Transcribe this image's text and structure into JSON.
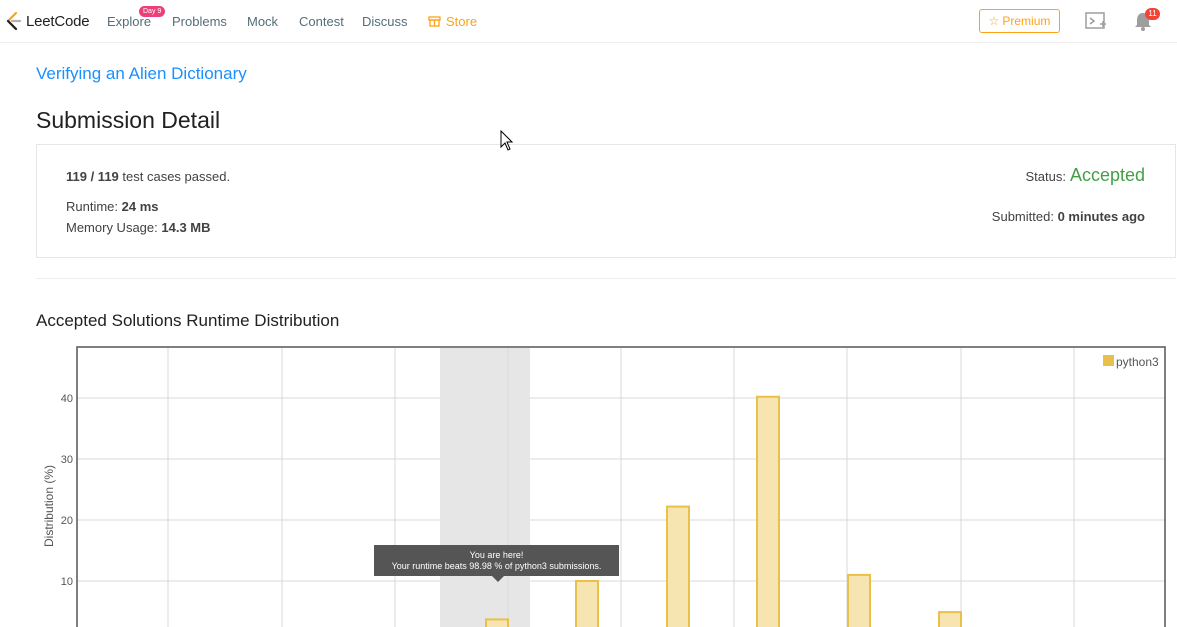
{
  "nav": {
    "logo_text": "LeetCode",
    "explore": "Explore",
    "explore_badge": "Day 9",
    "problems": "Problems",
    "mock": "Mock",
    "contest": "Contest",
    "discuss": "Discuss",
    "store": "Store",
    "premium": "Premium",
    "notification_count": "11"
  },
  "problem": {
    "title": "Verifying an Alien Dictionary"
  },
  "page_title": "Submission Detail",
  "submission": {
    "passed": "119 / 119",
    "passed_suffix": "test cases passed.",
    "runtime_label": "Runtime:",
    "runtime_value": "24 ms",
    "memory_label": "Memory Usage:",
    "memory_value": "14.3 MB",
    "status_label": "Status:",
    "status_value": "Accepted",
    "submitted_label": "Submitted:",
    "submitted_value": "0 minutes ago"
  },
  "colors": {
    "accent": "#ffa116",
    "accepted": "#43a047",
    "link": "#1a90ff",
    "bar_fill": "#f6e5b0",
    "bar_stroke": "#e8c04a"
  },
  "chart_data": {
    "type": "bar",
    "title": "Accepted Solutions Runtime Distribution",
    "ylabel": "Distribution (%)",
    "xlabel": "",
    "yticks": [
      "10",
      "20",
      "30",
      "40"
    ],
    "ylim": [
      0,
      46
    ],
    "legend": "python3",
    "legend_position": "top-right",
    "grid": true,
    "series": [
      {
        "name": "python3",
        "values": [
          3.7,
          10,
          22.2,
          40.2,
          11,
          4.9
        ]
      }
    ],
    "highlighted_bar_index": 0,
    "tooltip": {
      "line1": "You are here!",
      "line2": "Your runtime beats 98.98 % of python3 submissions."
    }
  }
}
